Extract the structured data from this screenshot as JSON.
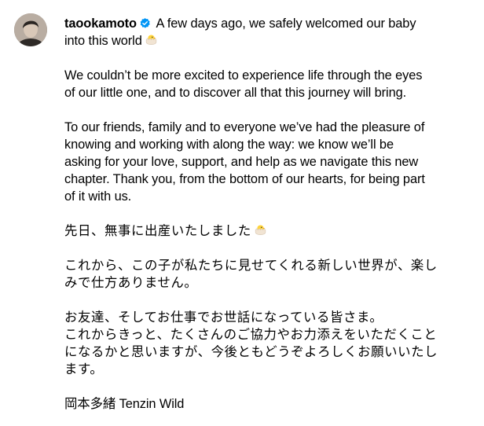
{
  "post": {
    "username": "taookamoto",
    "verified_icon": "verified-badge-icon",
    "accent_color": "#0095f6",
    "emoji_icon": "hatching-chick-icon",
    "first_line_text": " A few days ago, we safely welcomed our baby",
    "line_2": "into this world",
    "para_2": [
      "We couldn’t be more excited to experience life through the eyes",
      "of our little one, and to discover all that this journey will bring."
    ],
    "para_3": [
      "To our friends, family and to everyone we’ve had the pleasure of",
      "knowing and working with along the way: we know we’ll be",
      "asking for your love, support, and help as we navigate this new",
      "chapter. Thank you, from the bottom of our hearts, for being part",
      "of it with us."
    ],
    "jp_1": "先日、無事に出産いたしました",
    "jp_2": [
      "これから、この子が私たちに見せてくれる新しい世界が、楽し",
      "みで仕方ありません。"
    ],
    "jp_3": [
      "お友達、そしてお仕事でお世話になっている皆さま。",
      "これからきっと、たくさんのご協力やお力添えをいただくこと",
      "になるかと思いますが、今後ともどうぞよろしくお願いいたし",
      "ます。"
    ],
    "signature": "岡本多緒 Tenzin Wild"
  }
}
